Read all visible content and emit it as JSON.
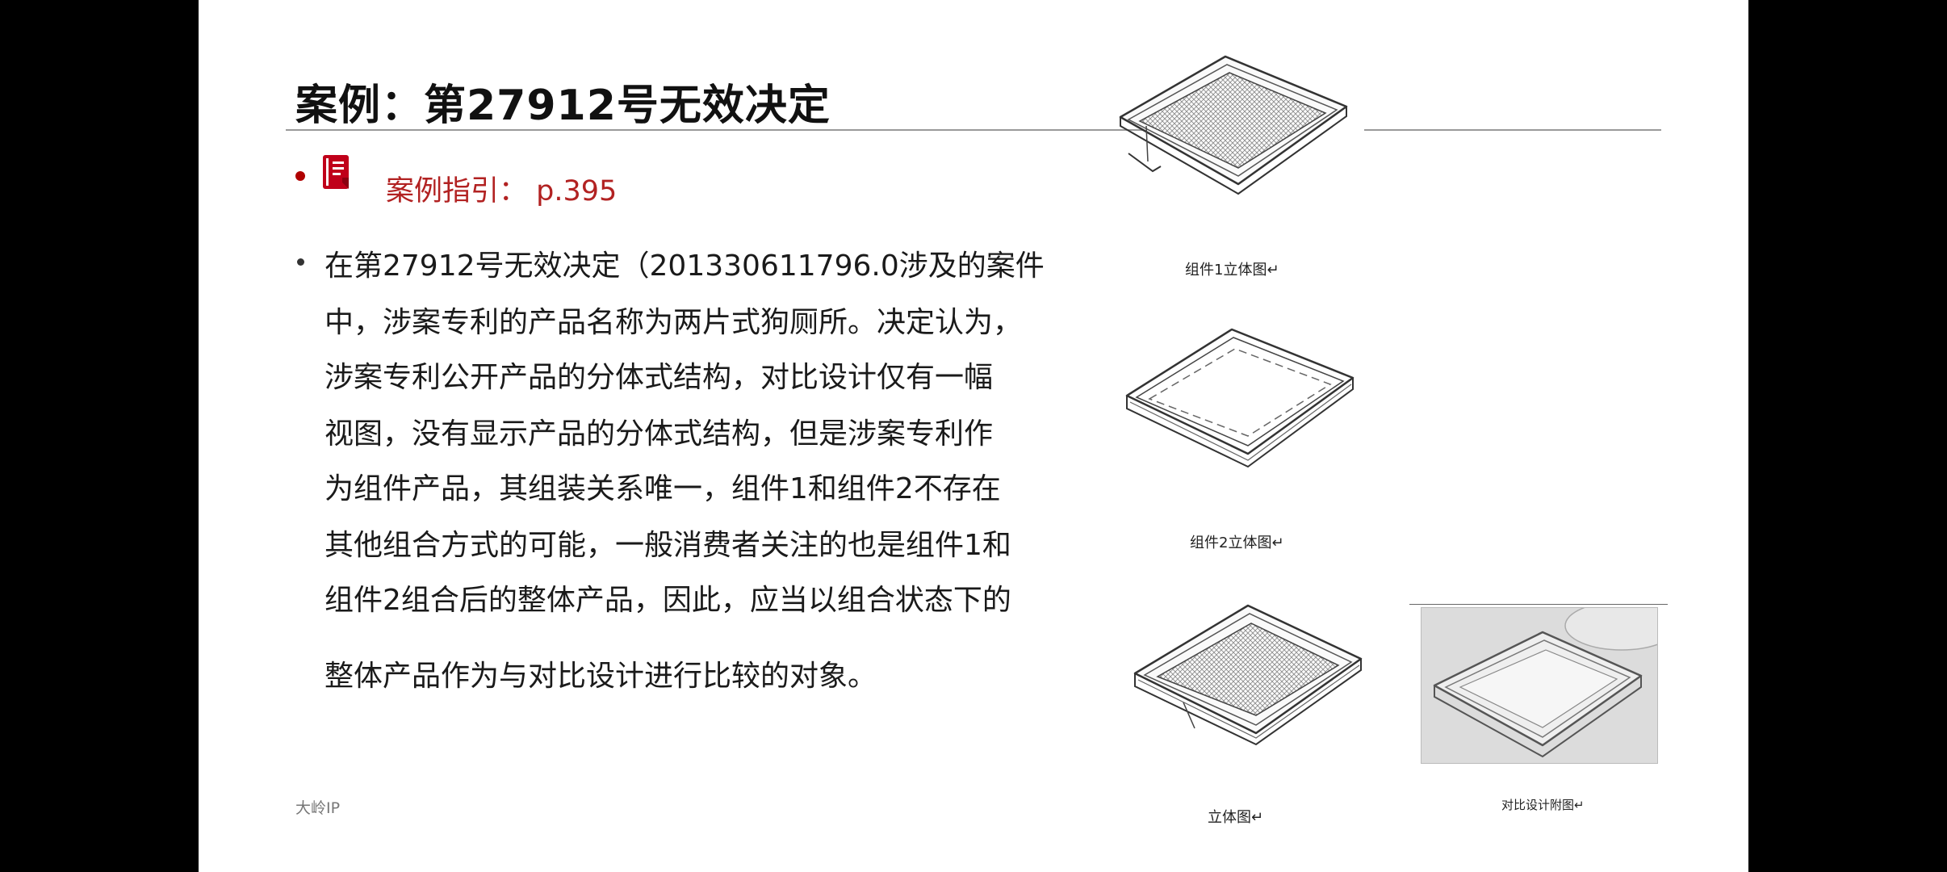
{
  "title": "案例：第27912号无效决定",
  "guide": {
    "label": "案例指引：",
    "page": "p.395"
  },
  "body": {
    "lines": [
      "在第27912号无效决定（201330611796.0涉及的案件",
      "中，涉案专利的产品名称为两片式狗厕所。决定认为，",
      "涉案专利公开产品的分体式结构，对比设计仅有一幅",
      "视图，没有显示产品的分体式结构，但是涉案专利作",
      "为组件产品，其组装关系唯一，组件1和组件2不存在",
      "其他组合方式的可能，一般消费者关注的也是组件1和",
      "组件2组合后的整体产品，因此，应当以组合状态下的",
      "整体产品作为与对比设计进行比较的对象。"
    ]
  },
  "figures": {
    "caption1": "组件1立体图↵",
    "caption2": "组件2立体图↵",
    "caption3": "立体图↵",
    "caption4": "对比设计附图↵"
  },
  "footer": "大岭IP",
  "colors": {
    "accent": "#b22222",
    "text": "#1a1a1a",
    "frame": "#000000"
  },
  "icons": {
    "guide": "book-icon"
  }
}
